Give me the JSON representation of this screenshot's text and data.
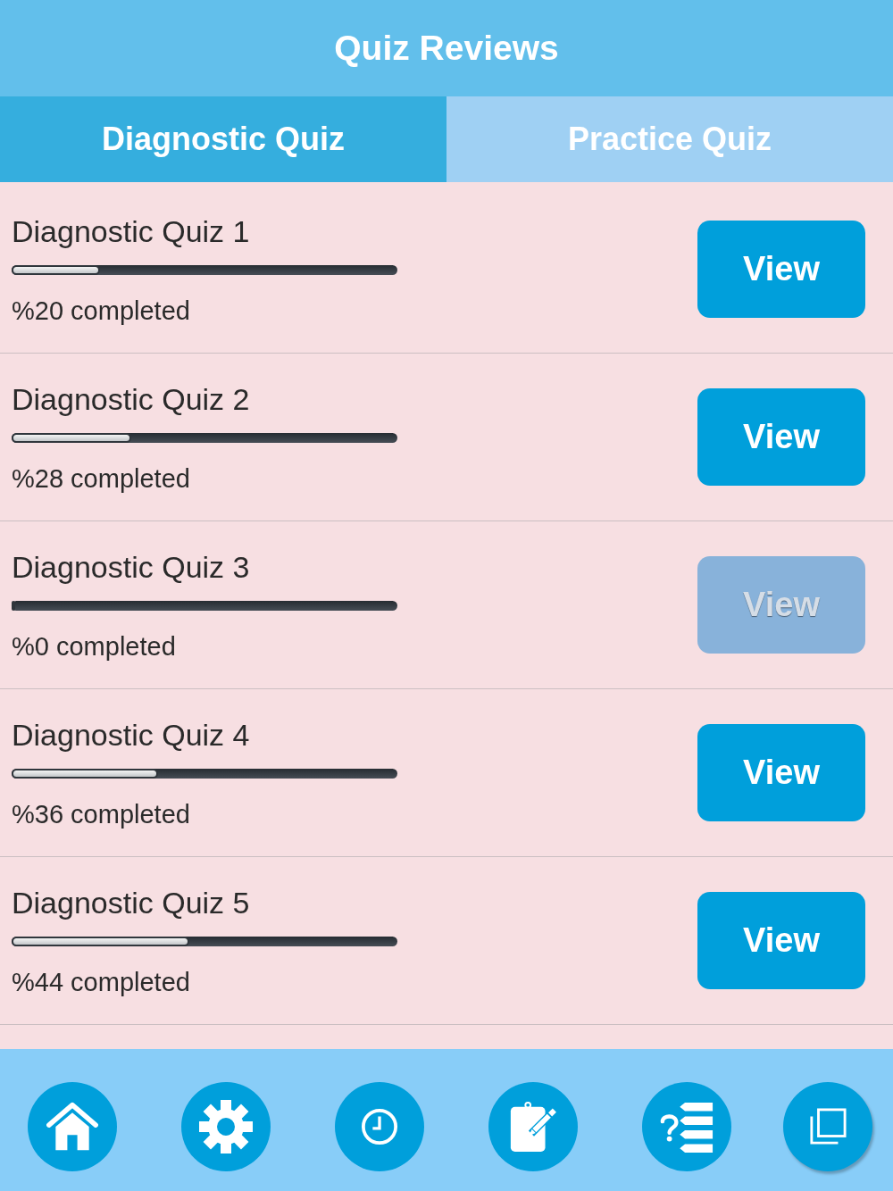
{
  "header": {
    "title": "Quiz Reviews"
  },
  "tabs": [
    {
      "label": "Diagnostic Quiz",
      "selected": true
    },
    {
      "label": "Practice Quiz",
      "selected": false
    }
  ],
  "quizzes": [
    {
      "title": "Diagnostic Quiz 1",
      "progress": {
        "level": 0.23
      },
      "reading": "%20 completed",
      "button": {
        "label": "View",
        "disabled": false
      }
    },
    {
      "title": "Diagnostic Quiz 2",
      "progress": {
        "level": 0.31
      },
      "reading": "%28 completed",
      "button": {
        "label": "View",
        "disabled": false
      }
    },
    {
      "title": "Diagnostic Quiz 3",
      "progress": {
        "level": 0
      },
      "reading": "%0 completed",
      "button": {
        "label": "View",
        "disabled": true
      }
    },
    {
      "title": "Diagnostic Quiz 4",
      "progress": {
        "level": 0.38
      },
      "reading": "%36 completed",
      "button": {
        "label": "View",
        "disabled": false
      }
    },
    {
      "title": "Diagnostic Quiz 5",
      "progress": {
        "level": 0.46
      },
      "reading": "%44 completed",
      "button": {
        "label": "View",
        "disabled": false
      }
    }
  ]
}
